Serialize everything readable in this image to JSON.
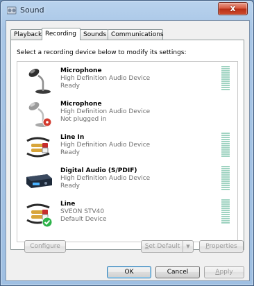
{
  "window": {
    "title": "Sound",
    "close_glyph": "x"
  },
  "tabs": [
    {
      "label": "Playback",
      "active": false
    },
    {
      "label": "Recording",
      "active": true
    },
    {
      "label": "Sounds",
      "active": false
    },
    {
      "label": "Communications",
      "active": false
    }
  ],
  "instruction": "Select a recording device below to modify its settings:",
  "devices": [
    {
      "name": "Microphone",
      "description": "High Definition Audio Device",
      "status": "Ready",
      "icon": "microphone-icon",
      "meter": true,
      "default": false,
      "unplugged": false
    },
    {
      "name": "Microphone",
      "description": "High Definition Audio Device",
      "status": "Not plugged in",
      "icon": "microphone-unplugged-icon",
      "meter": false,
      "default": false,
      "unplugged": true
    },
    {
      "name": "Line In",
      "description": "High Definition Audio Device",
      "status": "Ready",
      "icon": "line-in-cable-icon",
      "meter": true,
      "default": false,
      "unplugged": false
    },
    {
      "name": "Digital Audio (S/PDIF)",
      "description": "High Definition Audio Device",
      "status": "Ready",
      "icon": "digital-audio-device-icon",
      "meter": true,
      "default": false,
      "unplugged": false
    },
    {
      "name": "Line",
      "description": "SVEON STV40",
      "status": "Default Device",
      "icon": "line-cable-default-icon",
      "meter": true,
      "default": true,
      "unplugged": false
    }
  ],
  "buttons": {
    "configure": {
      "label": "Configure",
      "accel": "C",
      "enabled": false
    },
    "set_default": {
      "label_accel": "S",
      "label_rest": "et Default",
      "enabled": false
    },
    "properties": {
      "label_accel": "P",
      "label_rest": "roperties",
      "enabled": false
    },
    "ok": {
      "label": "OK",
      "enabled": true
    },
    "cancel": {
      "label": "Cancel",
      "enabled": true
    },
    "apply": {
      "label_accel": "A",
      "label_rest": "pply",
      "enabled": false
    }
  },
  "colors": {
    "meter": "#9fd3c1",
    "default_check": "#2db34a",
    "unplugged_badge": "#d23a2e"
  }
}
